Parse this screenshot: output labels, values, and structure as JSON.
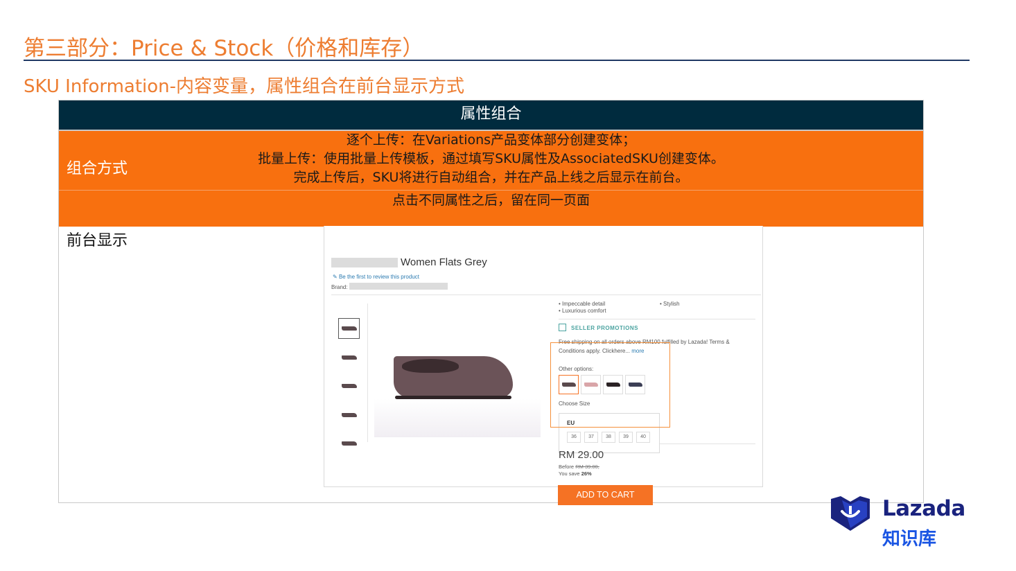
{
  "header": {
    "title": "第三部分：Price & Stock（价格和库存）",
    "subtitle": "SKU Information-内容变量，属性组合在前台显示方式"
  },
  "table": {
    "header": "属性组合",
    "row1": {
      "label": "组合方式",
      "lines": [
        "逐个上传：在Variations产品变体部分创建变体；",
        "批量上传：使用批量上传模板，通过填写SKU属性及AssociatedSKU创建变体。",
        "完成上传后，SKU将进行自动组合，并在产品上线之后显示在前台。"
      ]
    },
    "row2": {
      "text": "点击不同属性之后，留在同一页面"
    },
    "row3": {
      "label": "前台显示"
    }
  },
  "product_page": {
    "name": "Women Flats Grey",
    "review_link": "Be the first to review this product",
    "brand_label": "Brand:",
    "bullets_left": [
      "Impeccable detail",
      "Luxurious comfort"
    ],
    "bullet_right": "Stylish",
    "promo_title": "SELLER PROMOTIONS",
    "promo_text": "Free shipping on all orders above RM100 fulfilled by Lazada! Terms & Conditions apply. Clickhere...",
    "promo_more": "more",
    "other_options_label": "Other options:",
    "swatch_colors": [
      "#5a4a4d",
      "#d9a5a8",
      "#2a2224",
      "#3c3f55"
    ],
    "choose_size_label": "Choose Size",
    "size_system": "EU",
    "sizes": [
      "36",
      "37",
      "38",
      "39",
      "40"
    ],
    "price": "RM 29.00",
    "before_label": "Before",
    "before_price": "RM 39.00,",
    "save_label": "You save",
    "save_value": "26%",
    "cart_button": "ADD TO CART"
  },
  "logo": {
    "brand": "Lazada",
    "sub": "知识库",
    "colors": {
      "primary": "#1a237e",
      "accent": "#1a55e3"
    }
  },
  "colors": {
    "title_orange": "#ed7d31",
    "header_navy": "#002b3e",
    "row_orange": "#f8700f",
    "cart_orange": "#f57224"
  }
}
